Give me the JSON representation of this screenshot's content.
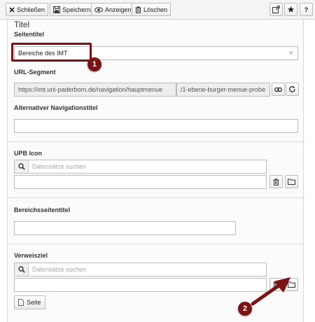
{
  "toolbar": {
    "close_label": "Schließen",
    "save_label": "Speichern",
    "view_label": "Anzeigen",
    "delete_label": "Löschen"
  },
  "form": {
    "section_title": "Titel",
    "seitentitel": {
      "label": "Seitentitel",
      "value": "Bereiche des IMT",
      "clear_symbol": "×"
    },
    "url_segment": {
      "label": "URL-Segment",
      "prefix": "https://imt.uni-paderborn.de/navigation/hauptmenue",
      "value": "/1-ebene-burger-menue-probe"
    },
    "nav_title": {
      "label": "Alternativer Navigationstitel",
      "value": ""
    },
    "upb_icon": {
      "label": "UPB Icon",
      "search_placeholder": "Datensätze suchen"
    },
    "bereichsseitentitel": {
      "label": "Bereichsseitentitel",
      "value": ""
    },
    "verweisziel": {
      "label": "Verweisziel",
      "search_placeholder": "Datensätze suchen",
      "page_button_label": "Seite"
    }
  },
  "annotations": {
    "marker_1": "1",
    "marker_2": "2"
  },
  "colors": {
    "annotation": "#7a1414",
    "toolbar_bg": "#f5f5f5",
    "panel_border": "#d9d9d9"
  }
}
